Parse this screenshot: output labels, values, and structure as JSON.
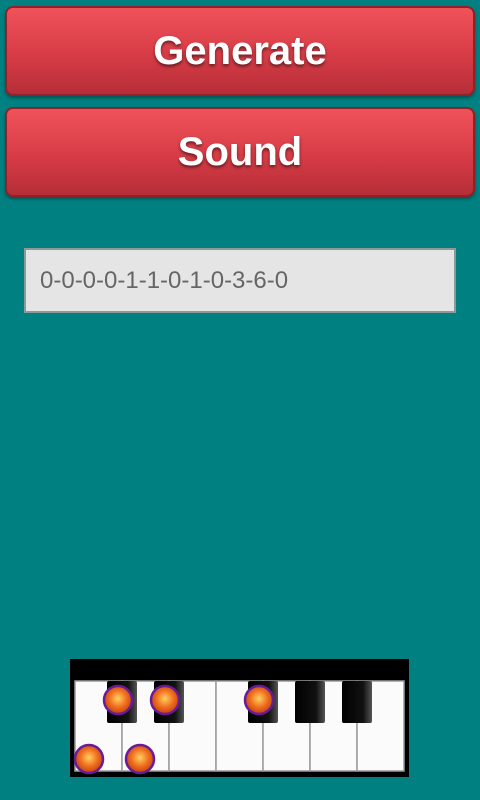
{
  "buttons": {
    "generate_label": "Generate",
    "sound_label": "Sound"
  },
  "sequence_field": {
    "value": "0-0-0-0-1-1-0-1-0-3-6-0"
  },
  "piano": {
    "white_keys": 7,
    "black_keys": 5,
    "marked_black_keys": [
      0,
      1,
      2
    ],
    "marked_white_keys": [
      0,
      1
    ],
    "colors": {
      "background": "#008080",
      "button": "#e04650",
      "marker_fill": "#f07020",
      "marker_ring": "#6a1b9a"
    }
  }
}
